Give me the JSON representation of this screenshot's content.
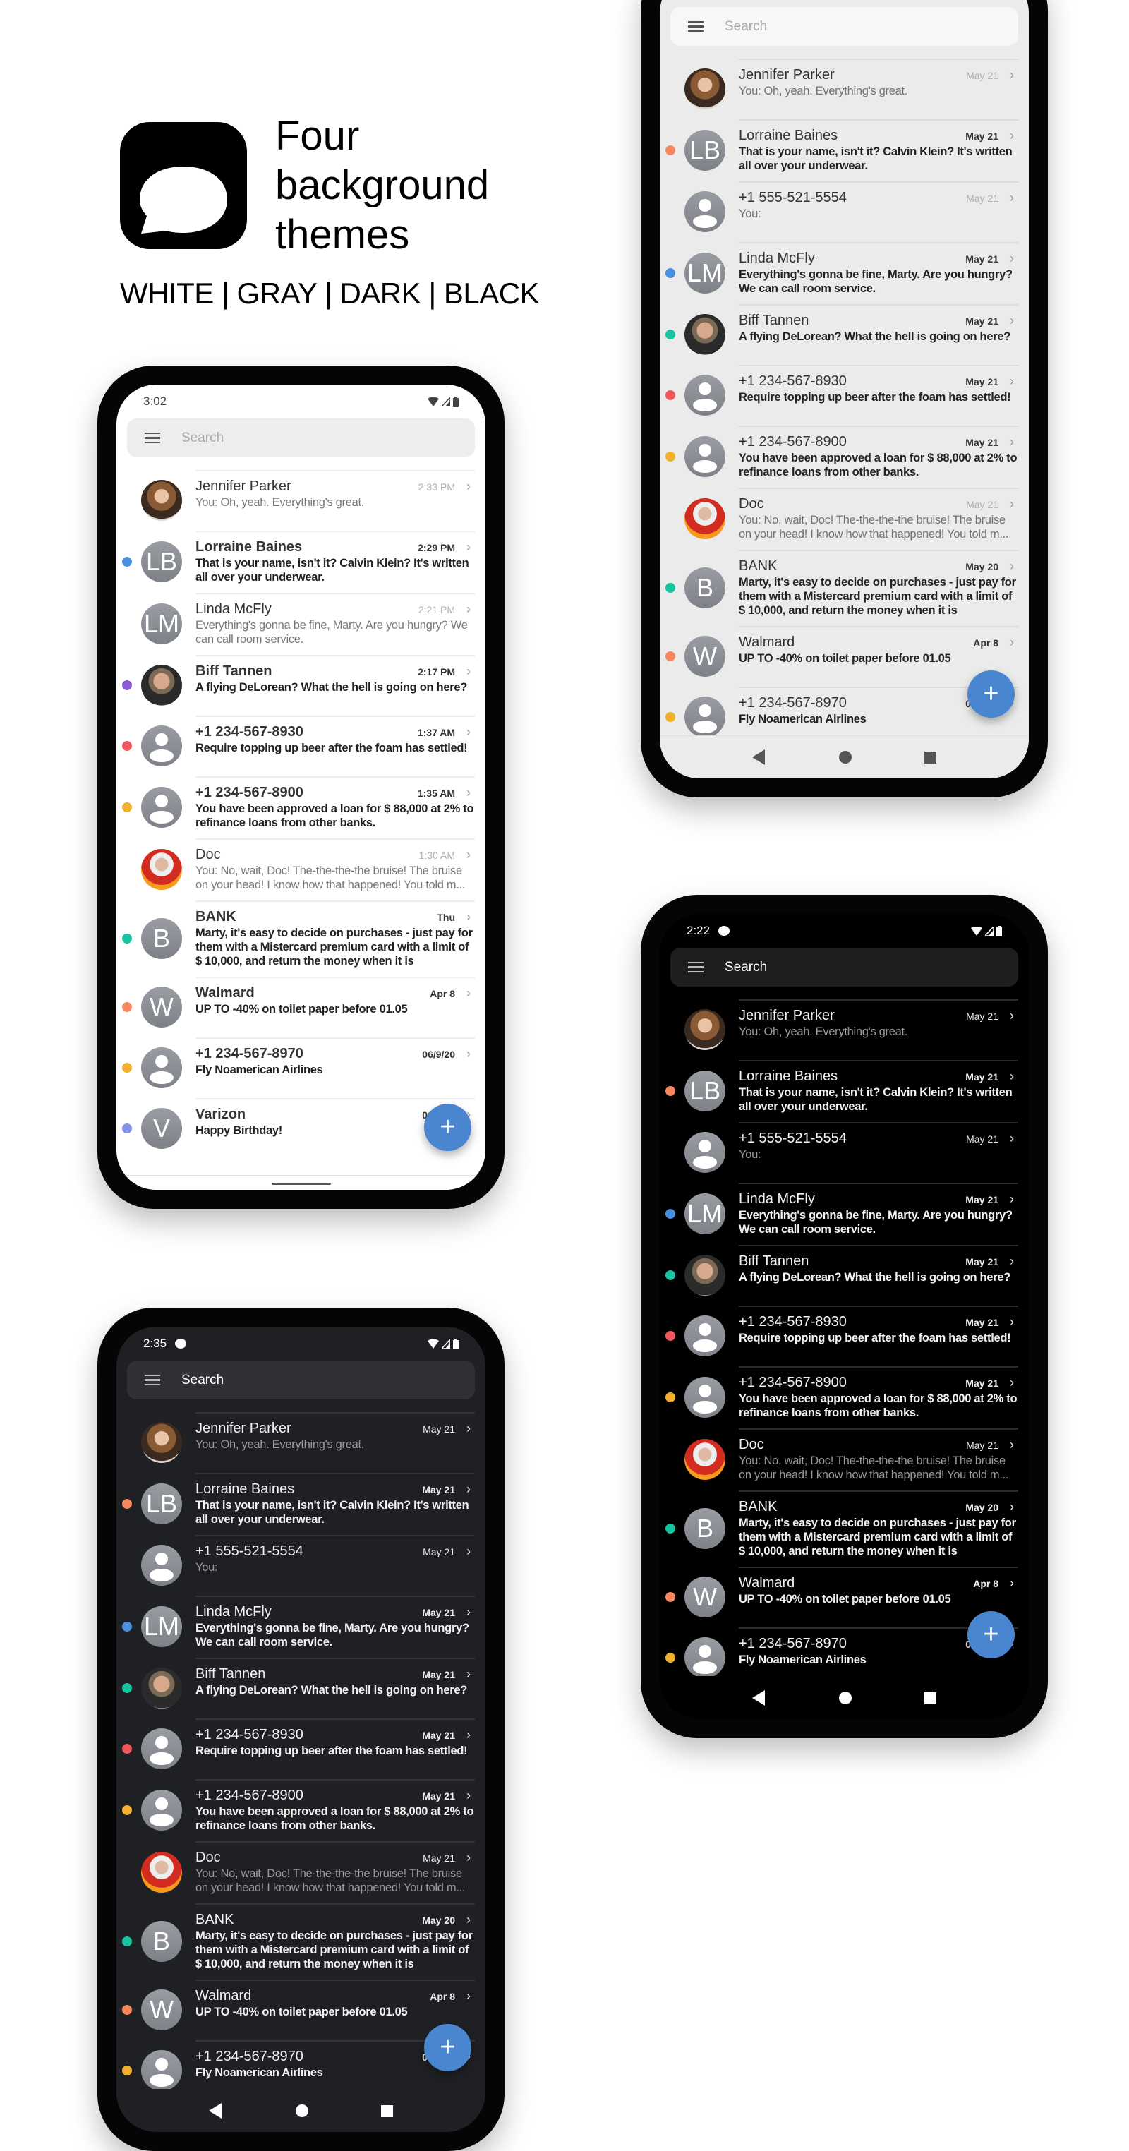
{
  "hero": {
    "title_lines": [
      "Four",
      "background",
      "themes"
    ],
    "subtitle": "WHITE | GRAY | DARK | BLACK",
    "logo_icon": "chat-bubble-icon"
  },
  "colors": {
    "fab": "#4a86d0",
    "blue": "#4a8fe0",
    "purple": "#8e5bd6",
    "red": "#f0575c",
    "yellow": "#f2b02e",
    "teal": "#17c3a0",
    "orange": "#f7875f",
    "periwinkle": "#8592ea"
  },
  "search_placeholder": "Search",
  "fab_label": "+",
  "chevron": ">",
  "phones": [
    {
      "theme": "white",
      "status_time": "3:02",
      "show_message_icon": false,
      "nav": "gesture",
      "conversations": [
        {
          "name": "Jennifer Parker",
          "preview": "You: Oh, yeah. Everything's great.",
          "time": "2:33 PM",
          "unread": false,
          "avatar": "photo-jennifer"
        },
        {
          "name": "Lorraine Baines",
          "preview": "That is your name, isn't it? Calvin Klein? It's written all over your underwear.",
          "time": "2:29 PM",
          "unread": true,
          "dot": "blue",
          "avatar": "initials",
          "initials": "LB"
        },
        {
          "name": "Linda McFly",
          "preview": "Everything's gonna be fine, Marty. Are you hungry? We can call room service.",
          "time": "2:21 PM",
          "unread": false,
          "avatar": "initials",
          "initials": "LM"
        },
        {
          "name": "Biff Tannen",
          "preview": "A flying DeLorean? What the hell is going on here?",
          "time": "2:17 PM",
          "unread": true,
          "dot": "purple",
          "avatar": "photo-biff"
        },
        {
          "name": "+1 234-567-8930",
          "preview": "Require topping up beer after the foam has settled!",
          "time": "1:37 AM",
          "unread": true,
          "dot": "red",
          "avatar": "person"
        },
        {
          "name": "+1 234-567-8900",
          "preview": "You have been approved a loan for $ 88,000 at 2% to refinance loans from other banks.",
          "time": "1:35 AM",
          "unread": true,
          "dot": "yellow",
          "avatar": "person"
        },
        {
          "name": "Doc",
          "preview": "You: No, wait, Doc! The-the-the-the bruise! The bruise on your head! I know how that happened! You told m...",
          "time": "1:30 AM",
          "unread": false,
          "avatar": "photo-doc"
        },
        {
          "name": "BANK",
          "preview": "Marty, it's easy to decide on purchases - just pay for them with a Mistercard premium card with a limit of $ 10,000, and return the money when it is convenient!",
          "time": "Thu",
          "unread": true,
          "dot": "teal",
          "avatar": "initials",
          "initials": "B"
        },
        {
          "name": "Walmard",
          "preview": "UP TO -40% on toilet paper before 01.05",
          "time": "Apr 8",
          "unread": true,
          "dot": "orange",
          "avatar": "initials",
          "initials": "W"
        },
        {
          "name": "+1 234-567-8970",
          "preview": "Fly Noamerican Airlines",
          "time": "06/9/20",
          "unread": true,
          "dot": "yellow",
          "avatar": "person"
        },
        {
          "name": "Varizon",
          "preview": "Happy Birthday!",
          "time": "06/9/20",
          "unread": true,
          "dot": "periwinkle",
          "avatar": "initials",
          "initials": "V"
        }
      ]
    },
    {
      "theme": "gray",
      "status_time": "",
      "show_message_icon": false,
      "nav": "buttons",
      "conversations": "shared"
    },
    {
      "theme": "black",
      "status_time": "2:22",
      "show_message_icon": true,
      "nav": "buttons",
      "conversations": "shared"
    },
    {
      "theme": "dark",
      "status_time": "2:35",
      "show_message_icon": true,
      "nav": "buttons",
      "conversations": "shared"
    }
  ],
  "shared_conversations": [
    {
      "name": "Jennifer Parker",
      "preview": "You: Oh, yeah. Everything's great.",
      "time": "May 21",
      "unread": false,
      "avatar": "photo-jennifer"
    },
    {
      "name": "Lorraine Baines",
      "preview": "That is your name, isn't it? Calvin Klein? It's written all over your underwear.",
      "time": "May 21",
      "unread": true,
      "dot": "orange",
      "avatar": "initials",
      "initials": "LB"
    },
    {
      "name": "+1 555-521-5554",
      "preview": "You:",
      "time": "May 21",
      "unread": false,
      "avatar": "person"
    },
    {
      "name": "Linda McFly",
      "preview": "Everything's gonna be fine, Marty. Are you hungry? We can call room service.",
      "time": "May 21",
      "unread": true,
      "dot": "blue",
      "avatar": "initials",
      "initials": "LM"
    },
    {
      "name": "Biff Tannen",
      "preview": "A flying DeLorean? What the hell is going on here?",
      "time": "May 21",
      "unread": true,
      "dot": "teal",
      "avatar": "photo-biff"
    },
    {
      "name": "+1 234-567-8930",
      "preview": "Require topping up beer after the foam has settled!",
      "time": "May 21",
      "unread": true,
      "dot": "red",
      "avatar": "person"
    },
    {
      "name": "+1 234-567-8900",
      "preview": "You have been approved a loan for $ 88,000 at 2% to refinance loans from other banks.",
      "time": "May 21",
      "unread": true,
      "dot": "yellow",
      "avatar": "person"
    },
    {
      "name": "Doc",
      "preview": "You: No, wait, Doc! The-the-the-the bruise! The bruise on your head! I know how that happened! You told m...",
      "time": "May 21",
      "unread": false,
      "avatar": "photo-doc"
    },
    {
      "name": "BANK",
      "preview": "Marty, it's easy to decide on purchases - just pay for them with a Mistercard premium card with a limit of $ 10,000, and return the money when it is convenient!",
      "time": "May 20",
      "unread": true,
      "dot": "teal",
      "avatar": "initials",
      "initials": "B"
    },
    {
      "name": "Walmard",
      "preview": "UP TO -40% on toilet paper before 01.05",
      "time": "Apr 8",
      "unread": true,
      "dot": "orange",
      "avatar": "initials",
      "initials": "W"
    },
    {
      "name": "+1 234-567-8970",
      "preview": "Fly Noamerican Airlines",
      "time": "06/9/20",
      "unread": true,
      "dot": "yellow",
      "avatar": "person"
    }
  ]
}
